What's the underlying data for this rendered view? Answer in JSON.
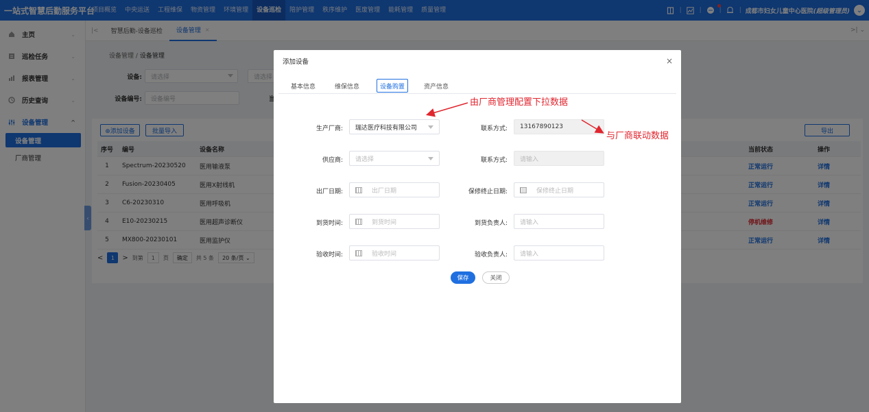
{
  "brand": "一站式智慧后勤服务平台",
  "top_nav": [
    "项目概览",
    "中央运送",
    "工程维保",
    "物资管理",
    "环境管理",
    "设备巡检",
    "陪护管理",
    "秩序维护",
    "医废管理",
    "能耗管理",
    "质量管理"
  ],
  "top_nav_active": "设备巡检",
  "user": {
    "name": "成都市妇女儿童中心医院",
    "role": "(超级管理员)"
  },
  "sidebar": {
    "items": [
      {
        "label": "主页",
        "icon": "home-icon"
      },
      {
        "label": "巡检任务",
        "icon": "task-icon"
      },
      {
        "label": "报表管理",
        "icon": "chart-icon"
      },
      {
        "label": "历史查询",
        "icon": "history-icon"
      },
      {
        "label": "设备管理",
        "icon": "device-icon"
      }
    ],
    "sub_items": [
      "设备管理",
      "厂商管理"
    ]
  },
  "tabs": [
    {
      "label": "智慧后勤-设备巡检"
    },
    {
      "label": "设备管理",
      "close": "×"
    }
  ],
  "breadcrumb": {
    "parent": "设备管理",
    "sep": "/",
    "current": "设备管理"
  },
  "filters": {
    "device_label": "设备:",
    "device_placeholder": "请选择",
    "device2_placeholder": "请选择",
    "code_label": "设备编号:",
    "code_placeholder": "设备编号",
    "current_label": "当"
  },
  "actions": {
    "add": "⊕添加设备",
    "import": "批量导入",
    "export": "导出"
  },
  "table": {
    "headers": [
      "序号",
      "编号",
      "设备名称",
      "当前状态",
      "操作"
    ],
    "rows": [
      {
        "idx": "1",
        "code": "Spectrum-20230520",
        "name": "医用输液泵",
        "status": "正常运行",
        "status_type": "ok",
        "op": "详情"
      },
      {
        "idx": "2",
        "code": "Fusion-20230405",
        "name": "医用X射线机",
        "status": "正常运行",
        "status_type": "ok",
        "op": "详情"
      },
      {
        "idx": "3",
        "code": "C6-20230310",
        "name": "医用呼吸机",
        "status": "正常运行",
        "status_type": "ok",
        "op": "详情"
      },
      {
        "idx": "4",
        "code": "E10-20230215",
        "name": "医用超声诊断仪",
        "status": "停机维修",
        "status_type": "stop",
        "op": "详情"
      },
      {
        "idx": "5",
        "code": "MX800-20230101",
        "name": "医用监护仪",
        "status": "正常运行",
        "status_type": "ok",
        "op": "详情"
      }
    ]
  },
  "pager": {
    "page": "1",
    "goto_label": "到第",
    "goto_value": "1",
    "page_unit": "页",
    "confirm": "确定",
    "total": "共 5 条",
    "per_page": "20 条/页 ⌄"
  },
  "modal": {
    "title": "添加设备",
    "close": "×",
    "tabs": [
      "基本信息",
      "维保信息",
      "设备购置",
      "资产信息"
    ],
    "active_tab": "设备购置",
    "fields": {
      "manufacturer_label": "生产厂商:",
      "manufacturer_value": "瑞达医疗科技有限公司",
      "contact1_label": "联系方式:",
      "contact1_value": "13167890123",
      "supplier_label": "供应商:",
      "supplier_placeholder": "请选择",
      "contact2_label": "联系方式:",
      "contact2_placeholder": "请输入",
      "factory_date_label": "出厂日期:",
      "factory_date_placeholder": "出厂日期",
      "warranty_end_label": "保修终止日期:",
      "warranty_end_placeholder": "保修终止日期",
      "arrival_time_label": "到货时间:",
      "arrival_time_placeholder": "到货时间",
      "arrival_owner_label": "到货负责人:",
      "arrival_owner_placeholder": "请输入",
      "accept_time_label": "验收时间:",
      "accept_time_placeholder": "验收时间",
      "accept_owner_label": "验收负责人:",
      "accept_owner_placeholder": "请输入"
    },
    "save": "保存",
    "close_btn": "关闭"
  },
  "annotations": {
    "a1": "由厂商管理配置下拉数据",
    "a2": "与厂商联动数据"
  },
  "colors": {
    "primary": "#1f6fe0",
    "danger": "#e0262f"
  }
}
